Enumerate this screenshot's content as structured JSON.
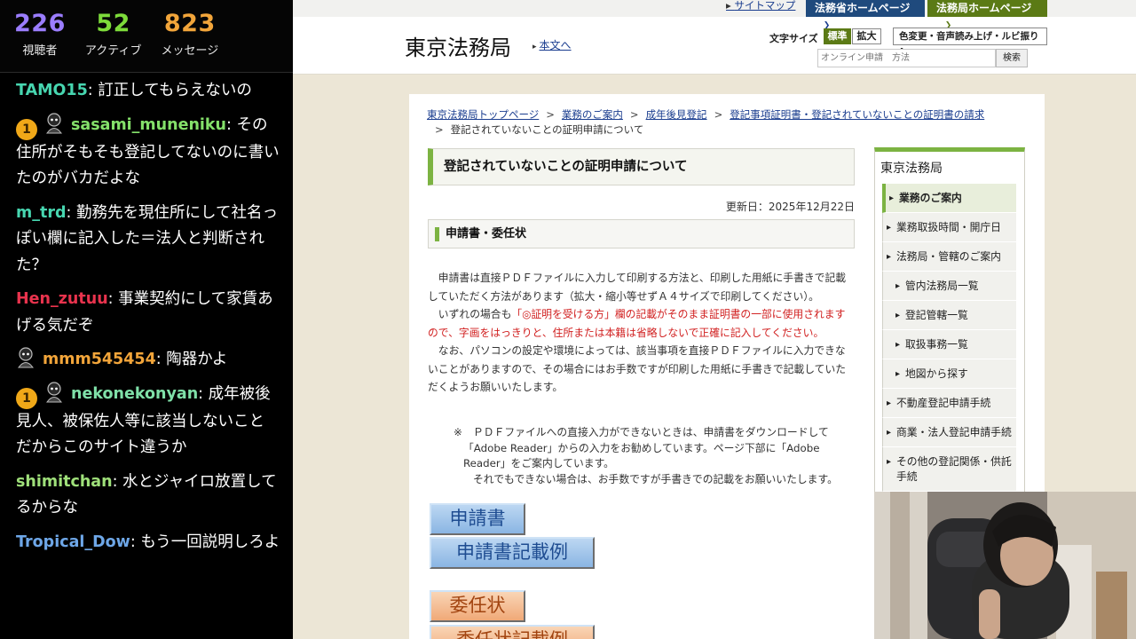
{
  "stats": [
    {
      "value": "226",
      "label": "視聴者",
      "color": "#9b7dff"
    },
    {
      "value": "52",
      "label": "アクティブ",
      "color": "#7ddb3a"
    },
    {
      "value": "823",
      "label": "メッセージ",
      "color": "#f2a53a"
    }
  ],
  "chat": [
    {
      "user": "TAMO15",
      "text": "訂正してもらえないの",
      "color": "#47d6b0",
      "sub_badge": "",
      "avatar": false
    },
    {
      "user": "sasami_muneniku",
      "text": "その住所がそもそも登記してないのに書いたのがバカだよな",
      "color": "#84e06a",
      "sub_badge": "1",
      "avatar": true
    },
    {
      "user": "m_trd",
      "text": "勤務先を現住所にして社名っぽい欄に記入した＝法人と判断された？",
      "color": "#47d6b0",
      "sub_badge": "",
      "avatar": false
    },
    {
      "user": "Hen_zutuu",
      "text": "事業契約にして家賃あげる気だぞ",
      "color": "#e8334d",
      "sub_badge": "",
      "avatar": false
    },
    {
      "user": "mmm545454",
      "text": "陶器かよ",
      "color": "#f2a53a",
      "sub_badge": "",
      "avatar": true
    },
    {
      "user": "nekonekonyan",
      "text": "成年被後見人、被保佐人等に該当しないこと　だからこのサイト違うか",
      "color": "#7fe0a8",
      "sub_badge": "1",
      "avatar": true
    },
    {
      "user": "shimitchan",
      "text": "水とジャイロ放置してるからな",
      "color": "#9fe07a",
      "sub_badge": "",
      "avatar": false
    },
    {
      "user": "Tropical_Dow",
      "text": "もう一回説明しろよ",
      "color": "#6ea7e8",
      "sub_badge": "",
      "avatar": false
    }
  ],
  "header": {
    "sitemap": "サイトマップ",
    "moj_home": "法務省ホームページ",
    "houmu_home": "法務局ホームページ",
    "site_title": "東京法務局",
    "skip_link": "本文へ",
    "font_size_label": "文字サイズ",
    "font_standard": "標準",
    "font_large": "拡大",
    "a11y_button": "色変更・音声読み上げ・ルビ振り",
    "search_placeholder": "オンライン申請　方法",
    "search_button": "検索"
  },
  "breadcrumb": {
    "items": [
      "東京法務局トップページ",
      "業務のご案内",
      "成年後見登記",
      "登記事項証明書・登記されていないことの証明書の請求"
    ],
    "current": "登記されていないことの証明申請について"
  },
  "main": {
    "title": "登記されていないことの証明申請について",
    "updated": "更新日：2025年12月22日",
    "section_title": "申請書・委任状",
    "para1": "申請書は直接ＰＤＦファイルに入力して印刷する方法と、印刷した用紙に手書きで記載していただく方法があります（拡大・縮小等せずＡ４サイズで印刷してください）。",
    "para2_pre": "いずれの場合も",
    "para2_red": "「◎証明を受ける方」欄の記載がそのまま証明書の一部に使用されますので、字画をはっきりと、住所または本籍は省略しないで正確に記入してください。",
    "para3": "なお、パソコンの設定や環境によっては、該当事項を直接ＰＤＦファイルに入力できないことがありますので、その場合にはお手数ですが印刷した用紙に手書きで記載していただくようお願いいたします。",
    "note_mark": "※",
    "note_line1": "ＰＤＦファイルへの直接入力ができないときは、申請書をダウンロードして",
    "note_line2": "「Adobe Reader」からの入力をお勧めしています。ページ下部に「Adobe",
    "note_line3": "Reader」をご案内しています。",
    "note_line4": "それでもできない場合は、お手数ですが手書きでの記載をお願いいたします。",
    "buttons": {
      "application": "申請書",
      "application_example": "申請書記載例",
      "power_of_attorney": "委任状",
      "power_of_attorney_example": "委任状記載例"
    }
  },
  "sidebar": {
    "title": "東京法務局",
    "items": [
      {
        "label": "業務のご案内"
      },
      {
        "label": "業務取扱時間・開庁日"
      },
      {
        "label": "法務局・管轄のご案内"
      },
      {
        "label": "管内法務局一覧"
      },
      {
        "label": "登記管轄一覧"
      },
      {
        "label": "取扱事務一覧"
      },
      {
        "label": "地図から探す"
      },
      {
        "label": "不動産登記申請手続"
      },
      {
        "label": "商業・法人登記申請手続"
      },
      {
        "label": "その他の登記関係・供託手続"
      }
    ]
  }
}
